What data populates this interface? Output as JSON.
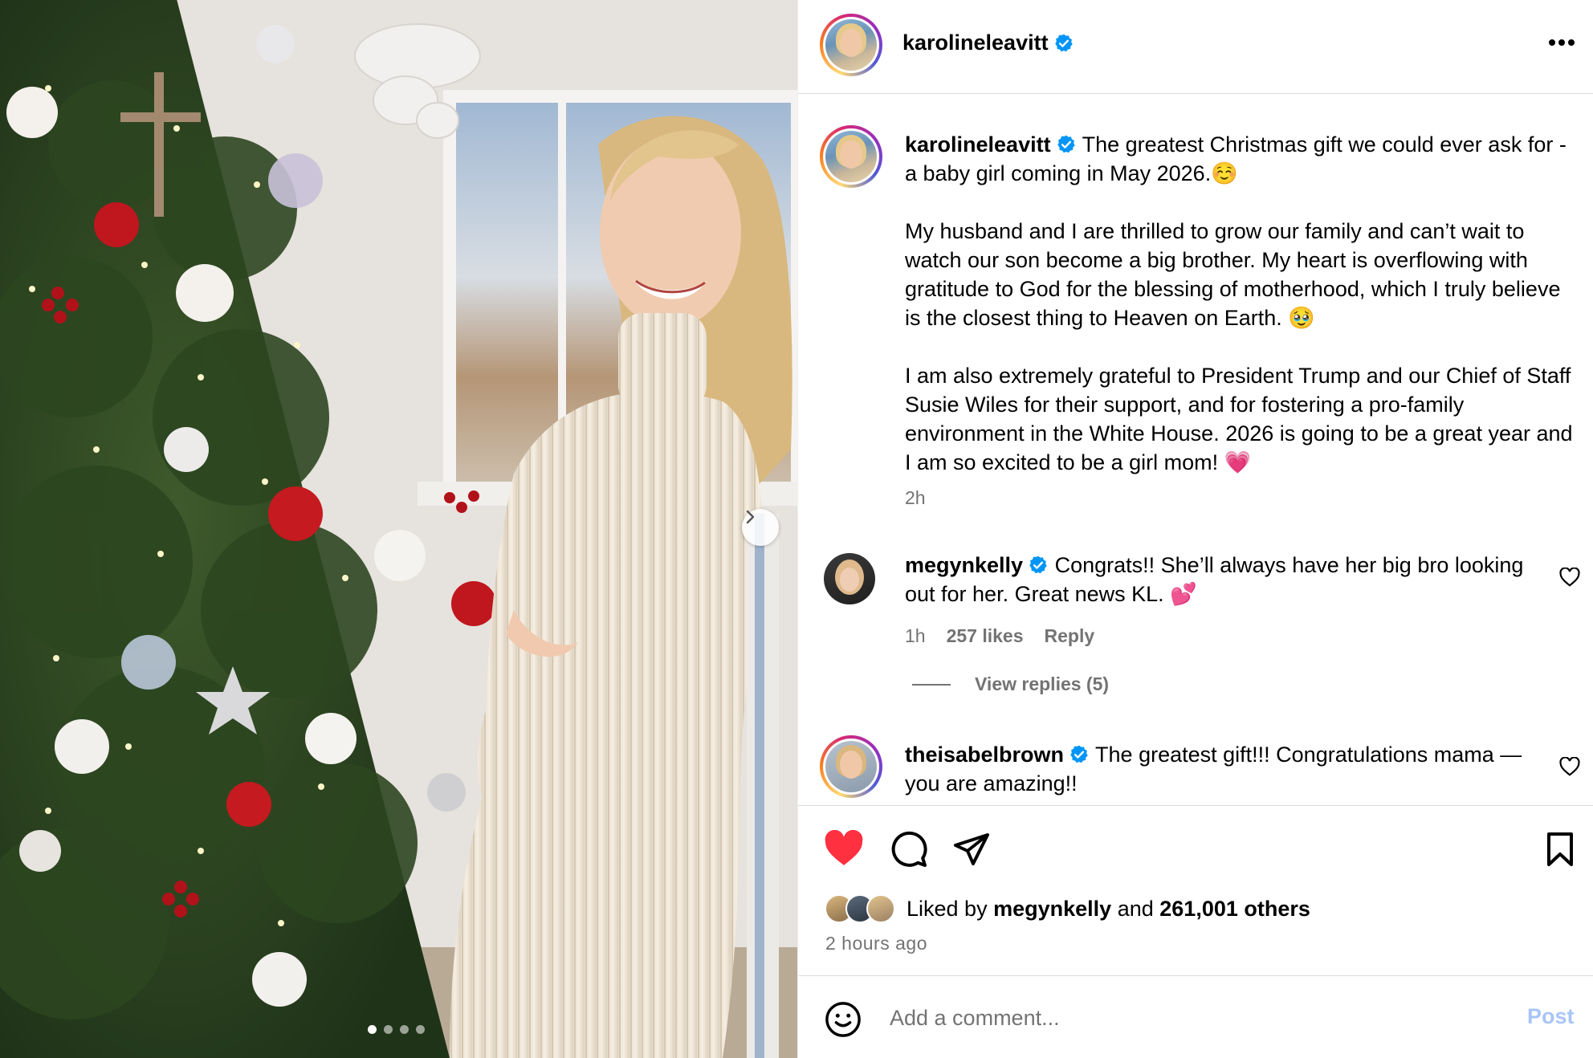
{
  "post": {
    "author": "karolineleavitt",
    "verified": true,
    "caption_paragraphs": [
      "The greatest Christmas gift we could ever ask for - a baby girl coming in May 2026.☺️",
      "My husband and I are thrilled to grow our family and can’t wait to watch our son become a big brother. My heart is overflowing with gratitude to God for the blessing of motherhood, which I truly believe is the closest thing to Heaven on Earth. 🥹",
      "I am also extremely grateful to President Trump and our Chief of Staff Susie Wiles for their support, and for fostering a pro-family environment in the White House. 2026 is going to be a great year and I am so excited to be a girl mom! 💗"
    ],
    "caption_time": "2h"
  },
  "comments": [
    {
      "user": "megynkelly",
      "text": "Congrats!! She’ll always have her big bro looking out for her. Great news KL. 💕",
      "time": "1h",
      "likes": "257 likes",
      "reply": "Reply",
      "view_replies": "View replies (5)"
    },
    {
      "user": "theisabelbrown",
      "text": "The greatest gift!!! Congratulations mama — you are amazing!!"
    }
  ],
  "actions": {
    "liked": true,
    "liked_by_prefix": "Liked by",
    "liked_by_user": "megynkelly",
    "liked_by_and": "and",
    "liked_by_others": "261,001 others",
    "time_ago": "2 hours ago"
  },
  "composer": {
    "placeholder": "Add a comment...",
    "post_label": "Post"
  },
  "carousel": {
    "slide_count": 4,
    "active_slide": 1
  },
  "colors": {
    "like_red": "#ff3040",
    "verified_blue": "#0095f6",
    "post_disabled": "#a8c5f7",
    "secondary_text": "#737373"
  }
}
